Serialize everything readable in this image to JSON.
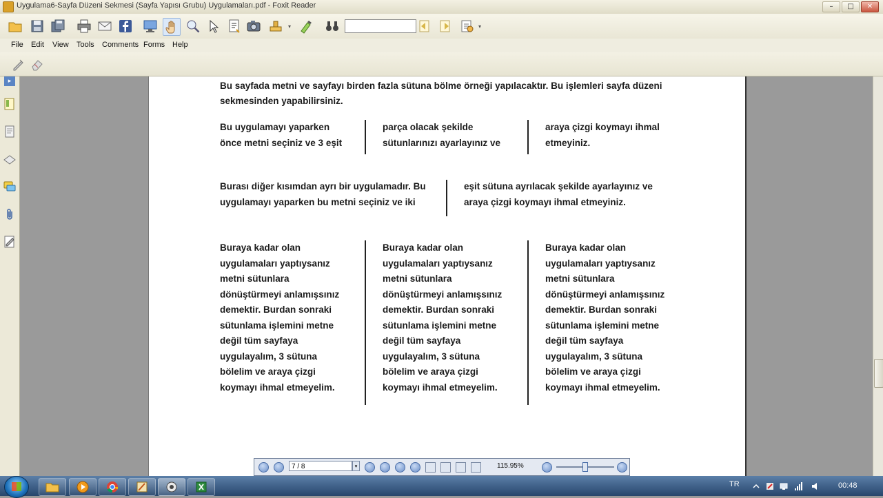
{
  "window": {
    "title": "Uygulama6-Sayfa Düzeni Sekmesi (Sayfa Yapısı Grubu) Uygulamaları.pdf - Foxit Reader"
  },
  "menu": [
    "File",
    "Edit",
    "View",
    "Tools",
    "Comments",
    "Forms",
    "Help"
  ],
  "document": {
    "intro": [
      "Bu sayfada metni ve sayfayı birden fazla sütuna bölme örneği yapılacaktır. Bu işlemleri sayfa düzeni",
      "sekmesinden yapabilirsiniz."
    ],
    "section1": [
      [
        "Bu uygulamayı yaparken",
        "önce metni seçiniz ve 3 eşit"
      ],
      [
        "parça olacak şekilde",
        "sütunlarınızı ayarlayınız ve"
      ],
      [
        "araya çizgi koymayı ihmal",
        "etmeyiniz."
      ]
    ],
    "section2": [
      [
        "Burası diğer kısımdan ayrı bir uygulamadır. Bu",
        "uygulamayı yaparken bu metni seçiniz ve iki"
      ],
      [
        "eşit sütuna ayrılacak şekilde ayarlayınız ve",
        "araya çizgi koymayı ihmal etmeyiniz."
      ]
    ],
    "section3_lines": [
      "Buraya kadar olan",
      "uygulamaları yaptıysanız",
      "metni sütunlara",
      "dönüştürmeyi anlamışsınız",
      "demektir. Burdan sonraki",
      "sütunlama işlemini metne",
      "değil tüm sayfaya",
      "uygulayalım, 3 sütuna",
      "bölelim ve araya çizgi",
      "koymayı ihmal etmeyelim."
    ]
  },
  "navigation": {
    "page_value": "7 / 8",
    "zoom": "115.95%"
  },
  "taskbar": {
    "language": "TR",
    "time": "00:48"
  }
}
